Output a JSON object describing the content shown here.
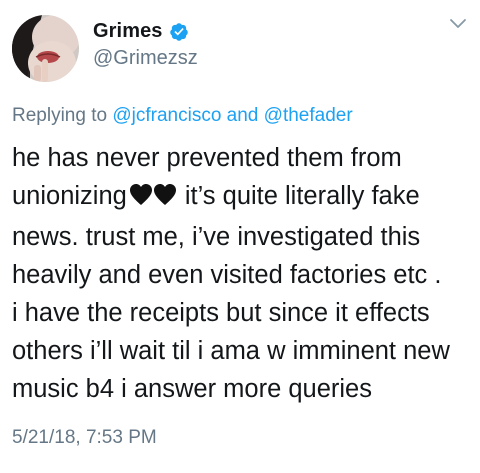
{
  "user": {
    "display_name": "Grimes",
    "handle": "@Grimezsz",
    "verified": true
  },
  "reply": {
    "prefix": "Replying to",
    "mention_1": "@jcfrancisco",
    "connector": "and",
    "mention_2": "@thefader"
  },
  "tweet": {
    "line_1": "he has never prevented them from",
    "line_2_before": "unionizing",
    "emoji": "🖤🖤",
    "line_2_after": "it’s quite literally fake",
    "line_3": "news.  trust me, i’ve investigated this",
    "line_4": "heavily and even visited factories etc .",
    "line_5": "i have the receipts but since it effects",
    "line_6": "others i’ll wait til i ama w imminent new",
    "line_7": "music b4 i answer more queries"
  },
  "timestamp": "5/21/18, 7:53 PM",
  "icons": {
    "verified": "verified-badge-icon",
    "caret": "chevron-down-icon",
    "heart": "black-heart-icon"
  },
  "colors": {
    "link": "#1da1f2",
    "secondary": "#657786",
    "text": "#14171a"
  }
}
